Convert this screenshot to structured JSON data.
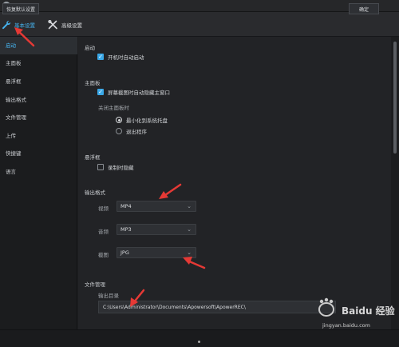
{
  "window": {
    "title": "设置",
    "accent": "#46b4f0"
  },
  "tabs": {
    "basic": "基本设置",
    "advanced": "高级设置"
  },
  "sidebar": {
    "items": [
      {
        "label": "启动"
      },
      {
        "label": "主面板"
      },
      {
        "label": "悬浮框"
      },
      {
        "label": "输出格式"
      },
      {
        "label": "文件管理"
      },
      {
        "label": "上传"
      },
      {
        "label": "快捷键"
      },
      {
        "label": "语言"
      }
    ]
  },
  "startup": {
    "title": "启动",
    "auto_start": "开机时自动启动",
    "auto_start_checked": true
  },
  "main_panel": {
    "title": "主面板",
    "hide_on_capture": "屏幕截图时自动隐藏主窗口",
    "hide_on_capture_checked": true,
    "on_close_label": "关闭主面板时",
    "minimize_tray": "最小化到系统托盘",
    "exit_program": "退出程序",
    "selected": "minimize_tray"
  },
  "float_box": {
    "title": "悬浮框",
    "hide_on_record": "录制时隐藏",
    "hide_on_record_checked": false
  },
  "output_format": {
    "title": "输出格式",
    "video_label": "视频",
    "video_value": "MP4",
    "audio_label": "音频",
    "audio_value": "MP3",
    "shot_label": "截图",
    "shot_value": "JPG"
  },
  "file_management": {
    "title": "文件管理",
    "dir_label": "输出目录",
    "dir_value": "C:\\Users\\Administrator\\Documents\\Apowersoft\\ApowerREC\\"
  },
  "bottom": {
    "reset": "恢复默认设置",
    "ok": "确定"
  },
  "watermark": {
    "brand": "Baidu 经验",
    "url": "jingyan.baidu.com"
  },
  "colors": {
    "annotation_arrow": "#e53935",
    "checkbox": "#3aa8e8"
  }
}
